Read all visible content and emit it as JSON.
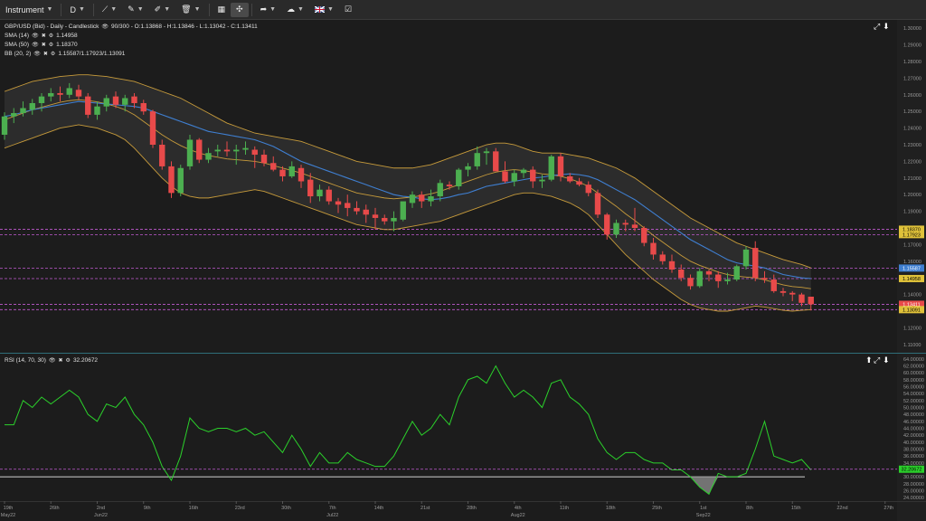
{
  "toolbar": {
    "items": [
      {
        "label": "Instrument",
        "dropdown": true
      },
      {
        "label": "D",
        "dropdown": true
      },
      {
        "icon": "draw-line-icon",
        "dropdown": true
      },
      {
        "icon": "pen-icon",
        "dropdown": true
      },
      {
        "icon": "pencil-ruler-icon",
        "dropdown": true
      },
      {
        "icon": "trash-icon",
        "dropdown": true
      },
      {
        "icon": "layout-icon"
      },
      {
        "icon": "crosshair-icon",
        "active": true
      },
      {
        "icon": "share-icon",
        "dropdown": true
      },
      {
        "icon": "cloud-icon",
        "dropdown": true
      },
      {
        "icon": "flag-uk-icon",
        "dropdown": true
      },
      {
        "icon": "checkbox-icon"
      }
    ]
  },
  "main_legend": {
    "instrument": "GBP/USD (Bid) - Daily - Candlestick",
    "ohlc": "90/300 - O:1.13868 - H:1.13846 - L:1.13042 - C:1.13411",
    "sma14_label": "SMA (14)",
    "sma14_value": "1.14958",
    "sma50_label": "SMA (50)",
    "sma50_value": "1.18370",
    "bb_label": "BB (20, 2)",
    "bb_value": "1.15587/1.17923/1.13091"
  },
  "rsi_legend": {
    "label": "RSI (14, 70, 30)",
    "value": "32.20672"
  },
  "colors": {
    "background": "#1c1c1c",
    "bull": "#4caf50",
    "bear": "#e84a4a",
    "bb": "#c79b3b",
    "sma14": "#3f7fd1",
    "rsi": "#2bd12b",
    "level_line": "#c05ad0"
  },
  "chart_data": [
    {
      "type": "candlestick",
      "title": "GBP/USD (Bid) - Daily - Candlestick",
      "y_ticks": [
        "1.30000",
        "1.29000",
        "1.28000",
        "1.27000",
        "1.26000",
        "1.25000",
        "1.24000",
        "1.23000",
        "1.22000",
        "1.21000",
        "1.20000",
        "1.19000",
        "1.18000",
        "1.17000",
        "1.16000",
        "1.15000",
        "1.14000",
        "1.13000",
        "1.12000",
        "1.11000"
      ],
      "ylim": [
        1.105,
        1.305
      ],
      "x_ticks": [
        {
          "label": "19th",
          "sub": "May22",
          "i": 0
        },
        {
          "label": "26th",
          "sub": "",
          "i": 5
        },
        {
          "label": "2nd",
          "sub": "Jun22",
          "i": 10
        },
        {
          "label": "9th",
          "sub": "",
          "i": 15
        },
        {
          "label": "16th",
          "sub": "",
          "i": 20
        },
        {
          "label": "23rd",
          "sub": "",
          "i": 25
        },
        {
          "label": "30th",
          "sub": "",
          "i": 30
        },
        {
          "label": "7th",
          "sub": "Jul22",
          "i": 35
        },
        {
          "label": "14th",
          "sub": "",
          "i": 40
        },
        {
          "label": "21st",
          "sub": "",
          "i": 45
        },
        {
          "label": "28th",
          "sub": "",
          "i": 50
        },
        {
          "label": "4th",
          "sub": "Aug22",
          "i": 55
        },
        {
          "label": "11th",
          "sub": "",
          "i": 60
        },
        {
          "label": "18th",
          "sub": "",
          "i": 65
        },
        {
          "label": "25th",
          "sub": "",
          "i": 70
        },
        {
          "label": "1st",
          "sub": "Sep22",
          "i": 75
        },
        {
          "label": "8th",
          "sub": "",
          "i": 80
        },
        {
          "label": "15th",
          "sub": "",
          "i": 85
        },
        {
          "label": "22nd",
          "sub": "",
          "i": 90
        },
        {
          "label": "27th",
          "sub": "",
          "i": 95
        },
        {
          "label": "3rd",
          "sub": "",
          "i": 100
        }
      ],
      "candles": [
        [
          1.236,
          1.2495,
          1.233,
          1.247
        ],
        [
          1.247,
          1.252,
          1.243,
          1.249
        ],
        [
          1.249,
          1.256,
          1.247,
          1.252
        ],
        [
          1.251,
          1.2575,
          1.248,
          1.255
        ],
        [
          1.255,
          1.261,
          1.25,
          1.259
        ],
        [
          1.259,
          1.264,
          1.256,
          1.261
        ],
        [
          1.261,
          1.265,
          1.256,
          1.26
        ],
        [
          1.26,
          1.267,
          1.258,
          1.264
        ],
        [
          1.263,
          1.266,
          1.257,
          1.259
        ],
        [
          1.259,
          1.261,
          1.246,
          1.248
        ],
        [
          1.248,
          1.256,
          1.245,
          1.253
        ],
        [
          1.253,
          1.26,
          1.25,
          1.258
        ],
        [
          1.259,
          1.262,
          1.252,
          1.254
        ],
        [
          1.254,
          1.26,
          1.25,
          1.258
        ],
        [
          1.259,
          1.261,
          1.252,
          1.255
        ],
        [
          1.255,
          1.257,
          1.248,
          1.25
        ],
        [
          1.25,
          1.251,
          1.228,
          1.23
        ],
        [
          1.23,
          1.233,
          1.215,
          1.217
        ],
        [
          1.217,
          1.22,
          1.198,
          1.201
        ],
        [
          1.201,
          1.218,
          1.199,
          1.216
        ],
        [
          1.217,
          1.236,
          1.215,
          1.233
        ],
        [
          1.233,
          1.234,
          1.219,
          1.221
        ],
        [
          1.221,
          1.228,
          1.219,
          1.225
        ],
        [
          1.226,
          1.23,
          1.223,
          1.227
        ],
        [
          1.227,
          1.232,
          1.223,
          1.226
        ],
        [
          1.226,
          1.23,
          1.218,
          1.227
        ],
        [
          1.227,
          1.232,
          1.224,
          1.228
        ],
        [
          1.227,
          1.229,
          1.216,
          1.224
        ],
        [
          1.224,
          1.227,
          1.217,
          1.219
        ],
        [
          1.219,
          1.223,
          1.214,
          1.215
        ],
        [
          1.215,
          1.217,
          1.208,
          1.211
        ],
        [
          1.211,
          1.22,
          1.21,
          1.217
        ],
        [
          1.216,
          1.218,
          1.204,
          1.208
        ],
        [
          1.209,
          1.213,
          1.195,
          1.199
        ],
        [
          1.199,
          1.206,
          1.196,
          1.203
        ],
        [
          1.203,
          1.205,
          1.194,
          1.196
        ],
        [
          1.196,
          1.198,
          1.189,
          1.194
        ],
        [
          1.195,
          1.2,
          1.187,
          1.192
        ],
        [
          1.192,
          1.196,
          1.188,
          1.19
        ],
        [
          1.191,
          1.194,
          1.183,
          1.188
        ],
        [
          1.188,
          1.192,
          1.179,
          1.186
        ],
        [
          1.186,
          1.188,
          1.182,
          1.184
        ],
        [
          1.184,
          1.19,
          1.178,
          1.186
        ],
        [
          1.185,
          1.195,
          1.184,
          1.196
        ],
        [
          1.195,
          1.202,
          1.192,
          1.2
        ],
        [
          1.2,
          1.202,
          1.192,
          1.196
        ],
        [
          1.196,
          1.203,
          1.193,
          1.199
        ],
        [
          1.199,
          1.209,
          1.196,
          1.207
        ],
        [
          1.206,
          1.208,
          1.203,
          1.205
        ],
        [
          1.205,
          1.216,
          1.203,
          1.215
        ],
        [
          1.215,
          1.219,
          1.211,
          1.217
        ],
        [
          1.217,
          1.229,
          1.215,
          1.225
        ],
        [
          1.225,
          1.228,
          1.218,
          1.226
        ],
        [
          1.226,
          1.228,
          1.214,
          1.214
        ],
        [
          1.214,
          1.22,
          1.207,
          1.208
        ],
        [
          1.208,
          1.215,
          1.205,
          1.213
        ],
        [
          1.213,
          1.216,
          1.21,
          1.215
        ],
        [
          1.215,
          1.217,
          1.204,
          1.208
        ],
        [
          1.208,
          1.212,
          1.204,
          1.209
        ],
        [
          1.209,
          1.224,
          1.208,
          1.223
        ],
        [
          1.223,
          1.225,
          1.208,
          1.211
        ],
        [
          1.211,
          1.213,
          1.207,
          1.208
        ],
        [
          1.208,
          1.21,
          1.205,
          1.206
        ],
        [
          1.206,
          1.208,
          1.199,
          1.201
        ],
        [
          1.201,
          1.203,
          1.186,
          1.188
        ],
        [
          1.188,
          1.189,
          1.173,
          1.176
        ],
        [
          1.176,
          1.185,
          1.174,
          1.183
        ],
        [
          1.183,
          1.185,
          1.178,
          1.182
        ],
        [
          1.182,
          1.192,
          1.178,
          1.18
        ],
        [
          1.18,
          1.181,
          1.169,
          1.171
        ],
        [
          1.171,
          1.174,
          1.161,
          1.164
        ],
        [
          1.164,
          1.166,
          1.158,
          1.16
        ],
        [
          1.16,
          1.164,
          1.153,
          1.155
        ],
        [
          1.155,
          1.158,
          1.148,
          1.15
        ],
        [
          1.15,
          1.152,
          1.143,
          1.145
        ],
        [
          1.145,
          1.156,
          1.144,
          1.154
        ],
        [
          1.154,
          1.155,
          1.148,
          1.152
        ],
        [
          1.152,
          1.154,
          1.144,
          1.148
        ],
        [
          1.148,
          1.153,
          1.146,
          1.149
        ],
        [
          1.149,
          1.158,
          1.148,
          1.157
        ],
        [
          1.157,
          1.169,
          1.155,
          1.167
        ],
        [
          1.168,
          1.172,
          1.148,
          1.15
        ],
        [
          1.15,
          1.154,
          1.147,
          1.149
        ],
        [
          1.149,
          1.152,
          1.141,
          1.142
        ],
        [
          1.142,
          1.144,
          1.139,
          1.141
        ],
        [
          1.141,
          1.142,
          1.136,
          1.14
        ],
        [
          1.14,
          1.141,
          1.133,
          1.135
        ],
        [
          1.1387,
          1.1385,
          1.1304,
          1.1341
        ]
      ],
      "sma14": [
        1.247,
        1.248,
        1.2495,
        1.251,
        1.252,
        1.253,
        1.254,
        1.255,
        1.256,
        1.2555,
        1.255,
        1.2545,
        1.254,
        1.2535,
        1.253,
        1.252,
        1.25,
        1.248,
        1.246,
        1.244,
        1.242,
        1.24,
        1.238,
        1.237,
        1.236,
        1.235,
        1.234,
        1.233,
        1.231,
        1.229,
        1.226,
        1.223,
        1.22,
        1.218,
        1.216,
        1.214,
        1.212,
        1.21,
        1.208,
        1.206,
        1.204,
        1.202,
        1.2,
        1.199,
        1.1985,
        1.1975,
        1.197,
        1.1975,
        1.1985,
        1.2,
        1.201,
        1.203,
        1.205,
        1.206,
        1.207,
        1.208,
        1.209,
        1.21,
        1.2105,
        1.2115,
        1.212,
        1.2125,
        1.212,
        1.211,
        1.209,
        1.206,
        1.203,
        1.2,
        1.197,
        1.193,
        1.189,
        1.185,
        1.181,
        1.177,
        1.173,
        1.17,
        1.167,
        1.164,
        1.161,
        1.159,
        1.158,
        1.157,
        1.156,
        1.154,
        1.152,
        1.151,
        1.15,
        1.1496
      ],
      "bb_upper": [
        1.262,
        1.264,
        1.266,
        1.268,
        1.269,
        1.27,
        1.271,
        1.2715,
        1.272,
        1.272,
        1.2715,
        1.271,
        1.27,
        1.269,
        1.268,
        1.266,
        1.264,
        1.262,
        1.26,
        1.258,
        1.255,
        1.252,
        1.249,
        1.246,
        1.243,
        1.241,
        1.239,
        1.237,
        1.236,
        1.235,
        1.234,
        1.233,
        1.232,
        1.23,
        1.228,
        1.226,
        1.224,
        1.222,
        1.22,
        1.219,
        1.218,
        1.217,
        1.216,
        1.216,
        1.216,
        1.217,
        1.218,
        1.22,
        1.222,
        1.224,
        1.226,
        1.228,
        1.23,
        1.231,
        1.231,
        1.23,
        1.228,
        1.226,
        1.225,
        1.225,
        1.225,
        1.224,
        1.223,
        1.222,
        1.22,
        1.218,
        1.216,
        1.213,
        1.21,
        1.206,
        1.202,
        1.198,
        1.194,
        1.19,
        1.186,
        1.183,
        1.18,
        1.177,
        1.174,
        1.171,
        1.169,
        1.167,
        1.165,
        1.163,
        1.161,
        1.1595,
        1.158,
        1.156
      ],
      "bb_lower": [
        1.228,
        1.23,
        1.232,
        1.234,
        1.236,
        1.238,
        1.24,
        1.241,
        1.242,
        1.241,
        1.24,
        1.238,
        1.236,
        1.233,
        1.228,
        1.222,
        1.216,
        1.21,
        1.205,
        1.201,
        1.199,
        1.198,
        1.198,
        1.199,
        1.2,
        1.201,
        1.202,
        1.203,
        1.202,
        1.2,
        1.198,
        1.196,
        1.194,
        1.192,
        1.19,
        1.188,
        1.186,
        1.184,
        1.182,
        1.181,
        1.18,
        1.179,
        1.179,
        1.18,
        1.181,
        1.182,
        1.183,
        1.184,
        1.186,
        1.188,
        1.19,
        1.192,
        1.194,
        1.196,
        1.198,
        1.2,
        1.201,
        1.201,
        1.2,
        1.199,
        1.197,
        1.195,
        1.192,
        1.188,
        1.182,
        1.176,
        1.17,
        1.164,
        1.159,
        1.154,
        1.149,
        1.145,
        1.141,
        1.137,
        1.134,
        1.132,
        1.131,
        1.13,
        1.13,
        1.131,
        1.132,
        1.133,
        1.1325,
        1.1315,
        1.1305,
        1.13,
        1.1305,
        1.1309
      ],
      "bb_middle": [
        1.245,
        1.247,
        1.249,
        1.251,
        1.2525,
        1.254,
        1.2555,
        1.2565,
        1.257,
        1.2565,
        1.2558,
        1.2545,
        1.253,
        1.251,
        1.248,
        1.244,
        1.24,
        1.236,
        1.2325,
        1.2295,
        1.227,
        1.225,
        1.2235,
        1.2225,
        1.2215,
        1.221,
        1.2205,
        1.22,
        1.219,
        1.2175,
        1.216,
        1.2145,
        1.213,
        1.211,
        1.209,
        1.207,
        1.205,
        1.203,
        1.201,
        1.2,
        1.199,
        1.198,
        1.1975,
        1.198,
        1.1985,
        1.1995,
        1.2005,
        1.202,
        1.204,
        1.206,
        1.208,
        1.21,
        1.212,
        1.2135,
        1.2145,
        1.215,
        1.2145,
        1.2135,
        1.2125,
        1.212,
        1.211,
        1.2095,
        1.2075,
        1.205,
        1.201,
        1.197,
        1.193,
        1.1885,
        1.1845,
        1.18,
        1.1755,
        1.1715,
        1.1675,
        1.1635,
        1.16,
        1.1575,
        1.1555,
        1.1535,
        1.152,
        1.151,
        1.1505,
        1.15,
        1.1488,
        1.1473,
        1.1458,
        1.1448,
        1.1443,
        1.1435
      ],
      "levels": [
        {
          "value": 1.17923,
          "label": "1.18370",
          "color": "#e0c23a",
          "text": "#000000"
        },
        {
          "value": 1.176,
          "label": "1.17923",
          "color": "#e0c23a",
          "text": "#000000"
        },
        {
          "value": 1.15587,
          "label": "1.15587",
          "color": "#3f7fd1",
          "text": "#ffffff"
        },
        {
          "value": 1.14958,
          "label": "1.14958",
          "color": "#e0c23a",
          "text": "#000000"
        },
        {
          "value": 1.13411,
          "label": "1.13411",
          "color": "#e84a4a",
          "text": "#ffffff"
        },
        {
          "value": 1.13091,
          "label": "1.13091",
          "color": "#e0c23a",
          "text": "#000000"
        }
      ]
    },
    {
      "type": "line",
      "title": "RSI (14, 70, 30)",
      "y_ticks": [
        "64.00000",
        "62.00000",
        "60.00000",
        "58.00000",
        "56.00000",
        "54.00000",
        "52.00000",
        "50.00000",
        "48.00000",
        "46.00000",
        "44.00000",
        "42.00000",
        "40.00000",
        "38.00000",
        "36.00000",
        "34.00000",
        "32.00000",
        "30.00000",
        "28.00000",
        "26.00000",
        "24.00000"
      ],
      "ylim": [
        23,
        65
      ],
      "rsi": [
        45,
        45,
        52,
        50,
        53,
        51,
        53,
        55,
        53,
        48,
        46,
        51,
        50,
        53,
        48,
        45,
        40,
        33,
        29,
        36,
        47,
        44,
        43,
        44,
        44,
        43,
        44,
        42,
        43,
        40,
        37,
        42,
        38,
        33,
        37,
        34,
        34,
        37,
        35,
        34,
        33,
        33,
        36,
        41,
        46,
        42,
        44,
        48,
        45,
        53,
        58,
        59,
        57,
        62,
        57,
        53,
        55,
        53,
        50,
        57,
        58,
        53,
        51,
        48,
        41,
        37,
        35,
        37,
        37,
        35,
        34,
        34,
        32,
        32,
        30,
        27,
        25,
        31,
        30,
        30,
        31,
        38,
        46,
        36,
        35,
        34,
        35,
        32
      ],
      "overbought": 70,
      "oversold": 30,
      "current_label": "32.20672"
    }
  ]
}
